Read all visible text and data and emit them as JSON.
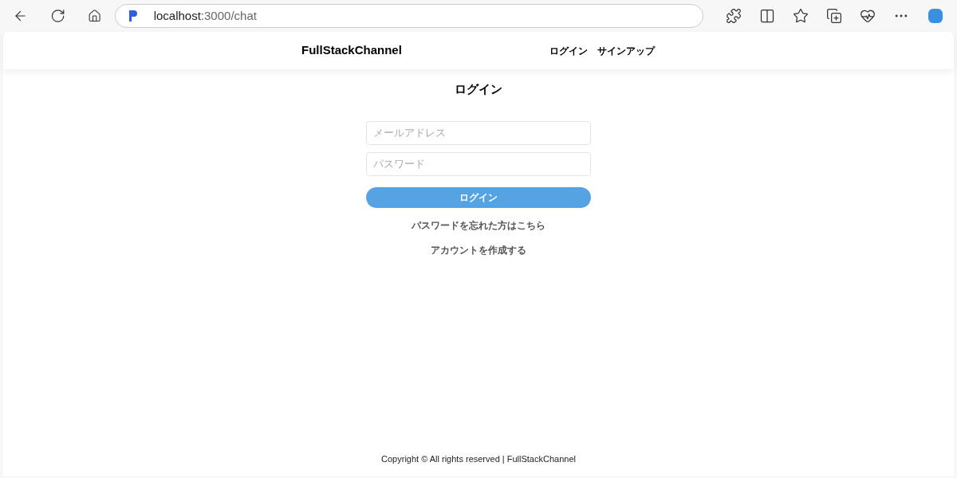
{
  "browser": {
    "url_host": "localhost",
    "url_path": ":3000/chat"
  },
  "header": {
    "brand": "FullStackChannel",
    "nav": [
      "ログイン",
      "サインアップ"
    ]
  },
  "login": {
    "title": "ログイン",
    "fields": [
      {
        "placeholder": "メールアドレス"
      },
      {
        "placeholder": "パスワード"
      }
    ],
    "submit": "ログイン",
    "links": [
      "パスワードを忘れた方はこちら",
      "アカウントを作成する"
    ]
  },
  "footer": "Copyright © All rights reserved | FullStackChannel"
}
